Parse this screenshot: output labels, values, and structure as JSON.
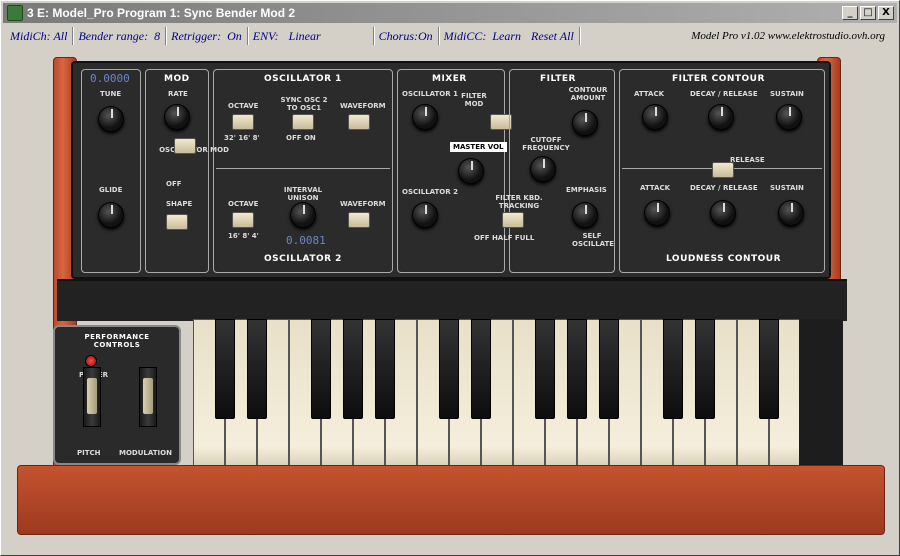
{
  "window": {
    "title": "3 E: Model_Pro Program 1: Sync Bender Mod 2",
    "minimize": "_",
    "maximize": "□",
    "close": "X"
  },
  "menubar": {
    "midich": "MidiCh: All",
    "bender": "Bender range:  8",
    "retrigger": "Retrigger:  On",
    "env_label": "ENV:",
    "env_value": "Linear",
    "chorus": "Chorus:On",
    "midicc": "MidiCC:  Learn",
    "reset": "Reset All",
    "version": "Model Pro v1.02     www.elektrostudio.ovh.org"
  },
  "sections": {
    "mod": "MOD",
    "osc1": "OSCILLATOR 1",
    "osc2": "OSCILLATOR 2",
    "mixer": "MIXER",
    "filter": "FILTER",
    "filter_contour": "FILTER CONTOUR",
    "loudness_contour": "LOUDNESS CONTOUR"
  },
  "readouts": {
    "tune": "0.0000",
    "osc2_interval": "0.0081"
  },
  "labels": {
    "tune": "TUNE",
    "glide": "GLIDE",
    "rate": "RATE",
    "shape": "SHAPE",
    "osc_mod": "OSCILLATOR MOD",
    "off": "OFF",
    "on": "ON",
    "octave": "OCTAVE",
    "sync": "SYNC OSC 2 TO OSC1",
    "waveform": "WAVEFORM",
    "oct_vals": "32'  16'  8'",
    "sync_vals": "OFF    ON",
    "interval": "INTERVAL UNISON",
    "oct2_vals": "16'  8'  4'",
    "mix_osc1": "OSCILLATOR 1",
    "mix_osc2": "OSCILLATOR 2",
    "master_vol": "MASTER VOL",
    "filter_mod": "FILTER MOD",
    "cutoff": "CUTOFF FREQUENCY",
    "kbd_track": "FILTER KBD. TRACKING",
    "kbd_vals": "OFF   HALF   FULL",
    "contour_amount": "CONTOUR AMOUNT",
    "emphasis": "EMPHASIS",
    "self_osc": "SELF OSCILLATE",
    "attack": "ATTACK",
    "decay": "DECAY / RELEASE",
    "sustain": "SUSTAIN",
    "release": "RELEASE",
    "perf": "PERFORMANCE CONTROLS",
    "power": "POWER",
    "pitch": "PITCH",
    "modulation": "MODULATION"
  }
}
